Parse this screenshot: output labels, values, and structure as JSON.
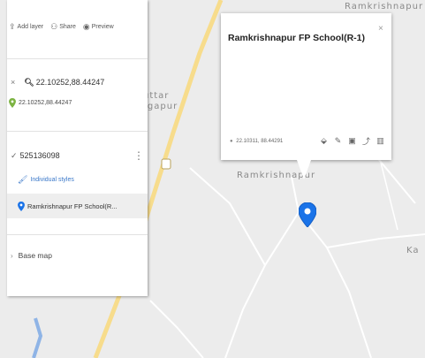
{
  "toolbar": {
    "add_layer": "Add layer",
    "share": "Share",
    "preview": "Preview"
  },
  "search": {
    "query": "22.10252,88.44247"
  },
  "result": {
    "label": "22.10252,88.44247"
  },
  "layer": {
    "name": "525136098",
    "styles_label": "Individual styles",
    "place": "Ramkrishnapur FP School(R..."
  },
  "basemap": {
    "label": "Base map"
  },
  "popup": {
    "title": "Ramkrishnapur FP School(R-1)",
    "coords": "22.10311, 88.44291"
  },
  "map_labels": {
    "top_right": "Ramkrishnapur",
    "behind_popup": "Ramkrishnapur",
    "right_edge": "Ka",
    "left_partial_1": "uttar",
    "left_partial_2": "rgapur"
  },
  "icons": {
    "add_layer": "add-layer-icon",
    "share": "share-icon",
    "preview": "preview-icon",
    "close": "close-icon",
    "search": "search-icon",
    "result_pin": "green-pin-icon",
    "layer_checkbox": "checkbox-checked-icon",
    "more": "more-vertical-icon",
    "styles": "paint-bucket-icon",
    "place_pin": "blue-pin-icon",
    "basemap_chevron": "chevron-right-icon",
    "popup_close": "close-icon",
    "popup_coords": "location-icon",
    "style": "paint-bucket-icon",
    "edit": "pencil-icon",
    "camera": "camera-icon",
    "directions": "directions-icon",
    "delete": "trash-icon",
    "map_marker": "map-marker-icon",
    "road_badge": "road-shield-icon"
  },
  "colors": {
    "map_bg": "#ececec",
    "road": "#ffffff",
    "highway": "#f5d97a",
    "water": "#8fb4e6",
    "marker": "#1a73e8",
    "pin_green": "#7cb342",
    "styles_link": "#3a78c9"
  }
}
